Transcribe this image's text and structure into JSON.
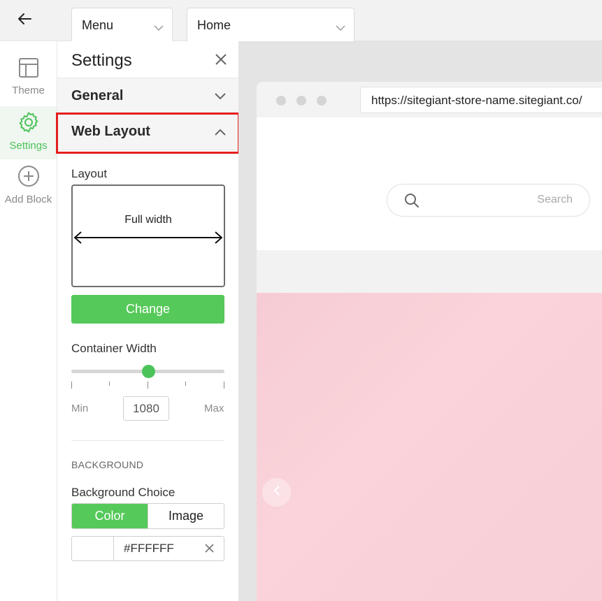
{
  "topbar": {
    "menu_dropdown": {
      "label": "Menu"
    },
    "page_dropdown": {
      "label": "Home"
    }
  },
  "rail": {
    "items": [
      {
        "label": "Theme",
        "icon": "layout-icon"
      },
      {
        "label": "Settings",
        "icon": "gear-icon",
        "active": true
      },
      {
        "label": "Add Block",
        "icon": "plus-circle-icon"
      }
    ]
  },
  "panel": {
    "title": "Settings",
    "sections": {
      "general": {
        "label": "General",
        "expanded": false
      },
      "web_layout": {
        "label": "Web Layout",
        "expanded": true
      }
    },
    "layout": {
      "label": "Layout",
      "preview_text": "Full width",
      "change_button": "Change"
    },
    "container_width": {
      "label": "Container Width",
      "min_label": "Min",
      "max_label": "Max",
      "value": "1080",
      "slider_fraction": 0.5
    },
    "background": {
      "section_caption": "BACKGROUND",
      "choice_label": "Background Choice",
      "options": [
        "Color",
        "Image"
      ],
      "selected": "Color",
      "color_value": "#FFFFFF"
    }
  },
  "preview": {
    "url": "https://sitegiant-store-name.sitegiant.co/",
    "search_placeholder": "Search"
  },
  "colors": {
    "accent": "#55c959",
    "highlight_border": "#e61e1e",
    "hero_background": "#f7cfd7"
  }
}
